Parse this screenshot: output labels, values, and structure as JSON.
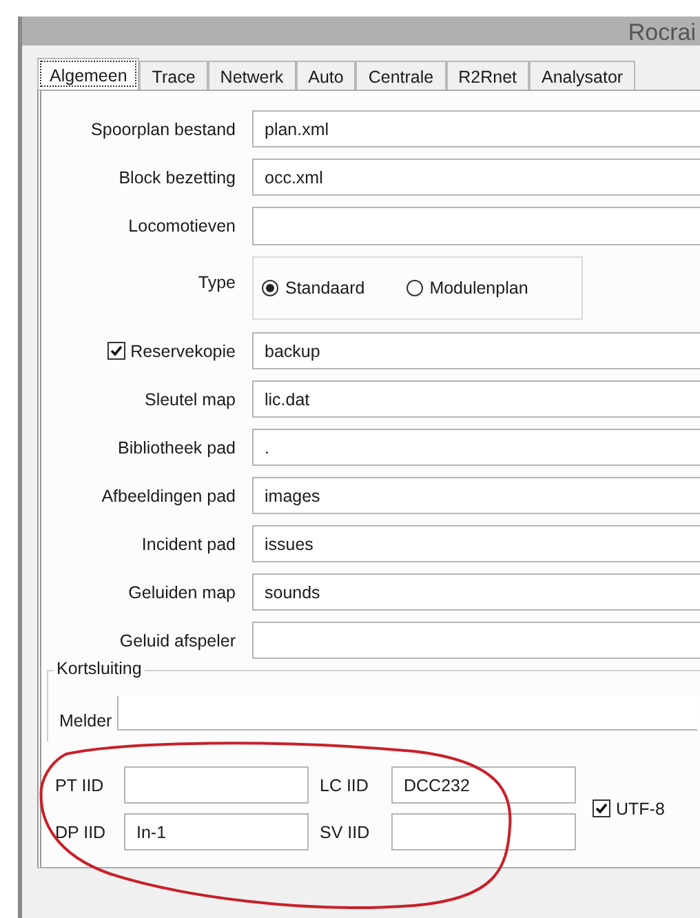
{
  "window": {
    "title": "Rocrai"
  },
  "tabs": [
    {
      "label": "Algemeen",
      "selected": true
    },
    {
      "label": "Trace",
      "selected": false
    },
    {
      "label": "Netwerk",
      "selected": false
    },
    {
      "label": "Auto",
      "selected": false
    },
    {
      "label": "Centrale",
      "selected": false
    },
    {
      "label": "R2Rnet",
      "selected": false
    },
    {
      "label": "Analysator",
      "selected": false
    }
  ],
  "fields": [
    {
      "kind": "text",
      "label": "Spoorplan bestand",
      "value": "plan.xml"
    },
    {
      "kind": "text",
      "label": "Block bezetting",
      "value": "occ.xml"
    },
    {
      "kind": "text",
      "label": "Locomotieven"
    },
    {
      "kind": "radio",
      "label": "Type",
      "options": [
        {
          "label": "Standaard",
          "selected": true
        },
        {
          "label": "Modulenplan",
          "selected": false
        }
      ]
    },
    {
      "kind": "checkbox",
      "label": "Reservekopie",
      "checked": true,
      "value": "backup"
    },
    {
      "kind": "text",
      "label": "Sleutel map",
      "value": "lic.dat"
    },
    {
      "kind": "text",
      "label": "Bibliotheek pad",
      "value": "."
    },
    {
      "kind": "text",
      "label": "Afbeeldingen pad",
      "value": "images"
    },
    {
      "kind": "text",
      "label": "Incident pad",
      "value": "issues"
    },
    {
      "kind": "text",
      "label": "Geluiden map",
      "value": "sounds"
    },
    {
      "kind": "text",
      "label": "Geluid afspeler"
    }
  ],
  "short_circuit": {
    "title": "Kortsluiting",
    "fields": [
      {
        "label": "Melder"
      }
    ]
  },
  "iid_fields": [
    {
      "label": "PT IID"
    },
    {
      "label": "LC IID",
      "value": "DCC232"
    },
    {
      "label": "DP IID",
      "value": "In-1"
    },
    {
      "label": "SV IID"
    }
  ],
  "utf8": {
    "label": "UTF-8",
    "checked": true
  }
}
